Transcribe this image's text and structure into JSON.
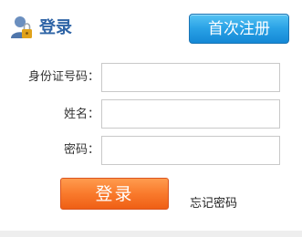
{
  "header": {
    "title": "登录",
    "icon": "user-lock-icon",
    "register_label": "首次注册"
  },
  "form": {
    "id_label": "身份证号码：",
    "id_value": "",
    "name_label": "姓名：",
    "name_value": "",
    "password_label": "密码：",
    "password_value": ""
  },
  "actions": {
    "login_label": "登录",
    "forgot_label": "忘记密码"
  },
  "colors": {
    "title": "#2e64a6",
    "register_button": "#2aa2e6",
    "login_button": "#f97a2c"
  }
}
